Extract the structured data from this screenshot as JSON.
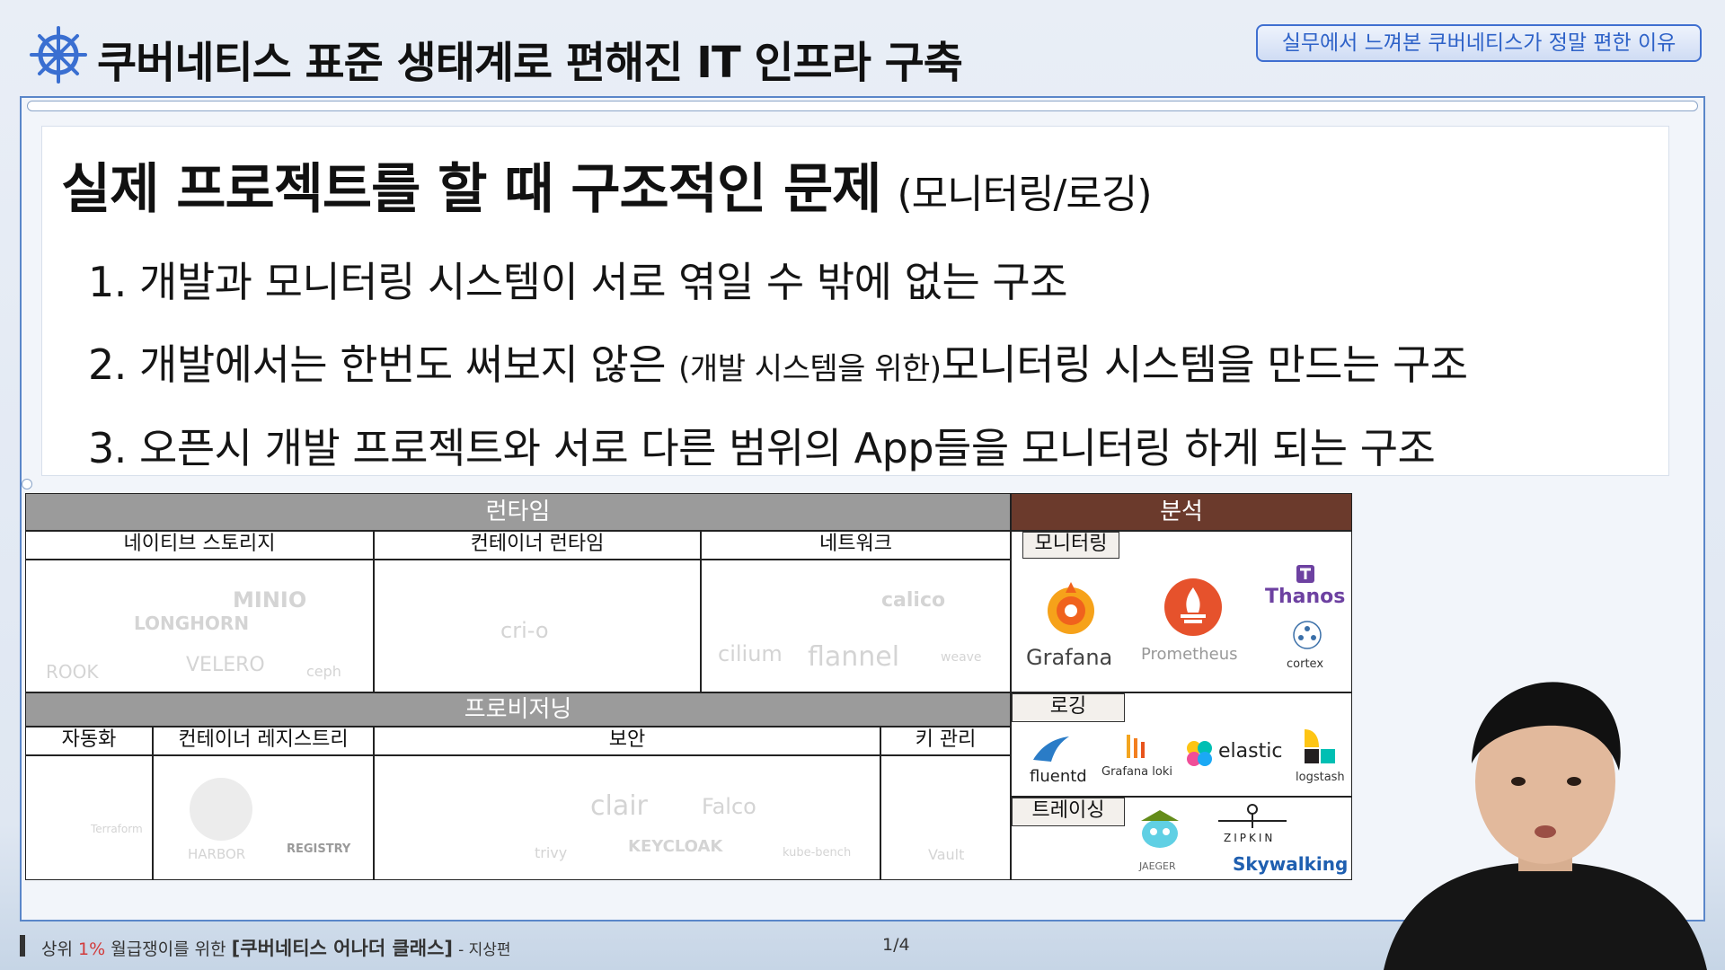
{
  "header": {
    "title": "쿠버네티스 표준 생태계로 편해진 IT 인프라 구축",
    "badge": "실무에서 느껴본 쿠버네티스가 정말 편한 이유"
  },
  "slide": {
    "subtitle": "실제 프로젝트를 할 때 구조적인 문제",
    "subtitle_note": "(모니터링/로깅)",
    "points": [
      {
        "text": "1. 개발과 모니터링 시스템이 서로 엮일 수 밖에 없는 구조"
      },
      {
        "text_a": "2. 개발에서는 한번도 써보지 않은",
        "note": "(개발 시스템을 위한)",
        "text_b": "모니터링 시스템을 만드는 구조"
      },
      {
        "text": "3. 오픈시 개발 프로젝트와 서로 다른 범위의 App들을 모니터링 하게 되는 구조"
      }
    ]
  },
  "grid": {
    "runtime": "런타임",
    "analysis": "분석",
    "provisioning": "프로비저닝",
    "native_storage": "네이티브 스토리지",
    "container_runtime": "컨테이너 런타임",
    "network": "네트워크",
    "monitoring": "모니터링",
    "logging": "로깅",
    "tracing": "트레이싱",
    "automation": "자동화",
    "container_registry": "컨테이너 레지스트리",
    "security": "보안",
    "key_management": "키 관리",
    "storage_logos": [
      "MINIO",
      "LONGHORN",
      "ROOK",
      "VELERO",
      "ceph"
    ],
    "runtime_logos": [
      "cri-o"
    ],
    "network_logos": [
      "cilium",
      "flannel",
      "weave",
      "calico"
    ],
    "monitoring_logos": [
      "Grafana",
      "Prometheus",
      "Thanos",
      "cortex"
    ],
    "logging_logos": [
      "fluentd",
      "Grafana loki",
      "elastic",
      "logstash"
    ],
    "tracing_logos": [
      "JAEGER",
      "ZIPKIN",
      "Skywalking"
    ],
    "automation_logos": [
      "Terraform"
    ],
    "registry_logos": [
      "HARBOR",
      "REGISTRY"
    ],
    "security_logos": [
      "trivy",
      "clair",
      "Falco",
      "KEYCLOAK",
      "kube-bench"
    ],
    "key_logos": [
      "Vault"
    ]
  },
  "footer": {
    "prefix": "상위",
    "percent": "1%",
    "middle": "월급쟁이를 위한",
    "course": "[쿠버네티스 어나더 클래스]",
    "suffix": "- 지상편",
    "page": "1/4"
  },
  "colors": {
    "accent_blue": "#3f6fd0",
    "band_gray": "#9b9b9b",
    "band_brown": "#6b3a2c",
    "grafana_orange": "#f0621d",
    "prometheus_red": "#e6522c",
    "thanos_purple": "#6d41a1",
    "fluentd_blue": "#2a7cc7",
    "footer_red": "#d23a3a"
  },
  "icons": [
    "kubernetes-wheel-icon",
    "grafana-icon",
    "prometheus-icon",
    "thanos-icon",
    "cortex-icon",
    "fluentd-icon",
    "loki-icon",
    "elastic-icon",
    "logstash-icon",
    "jaeger-icon",
    "zipkin-icon"
  ]
}
